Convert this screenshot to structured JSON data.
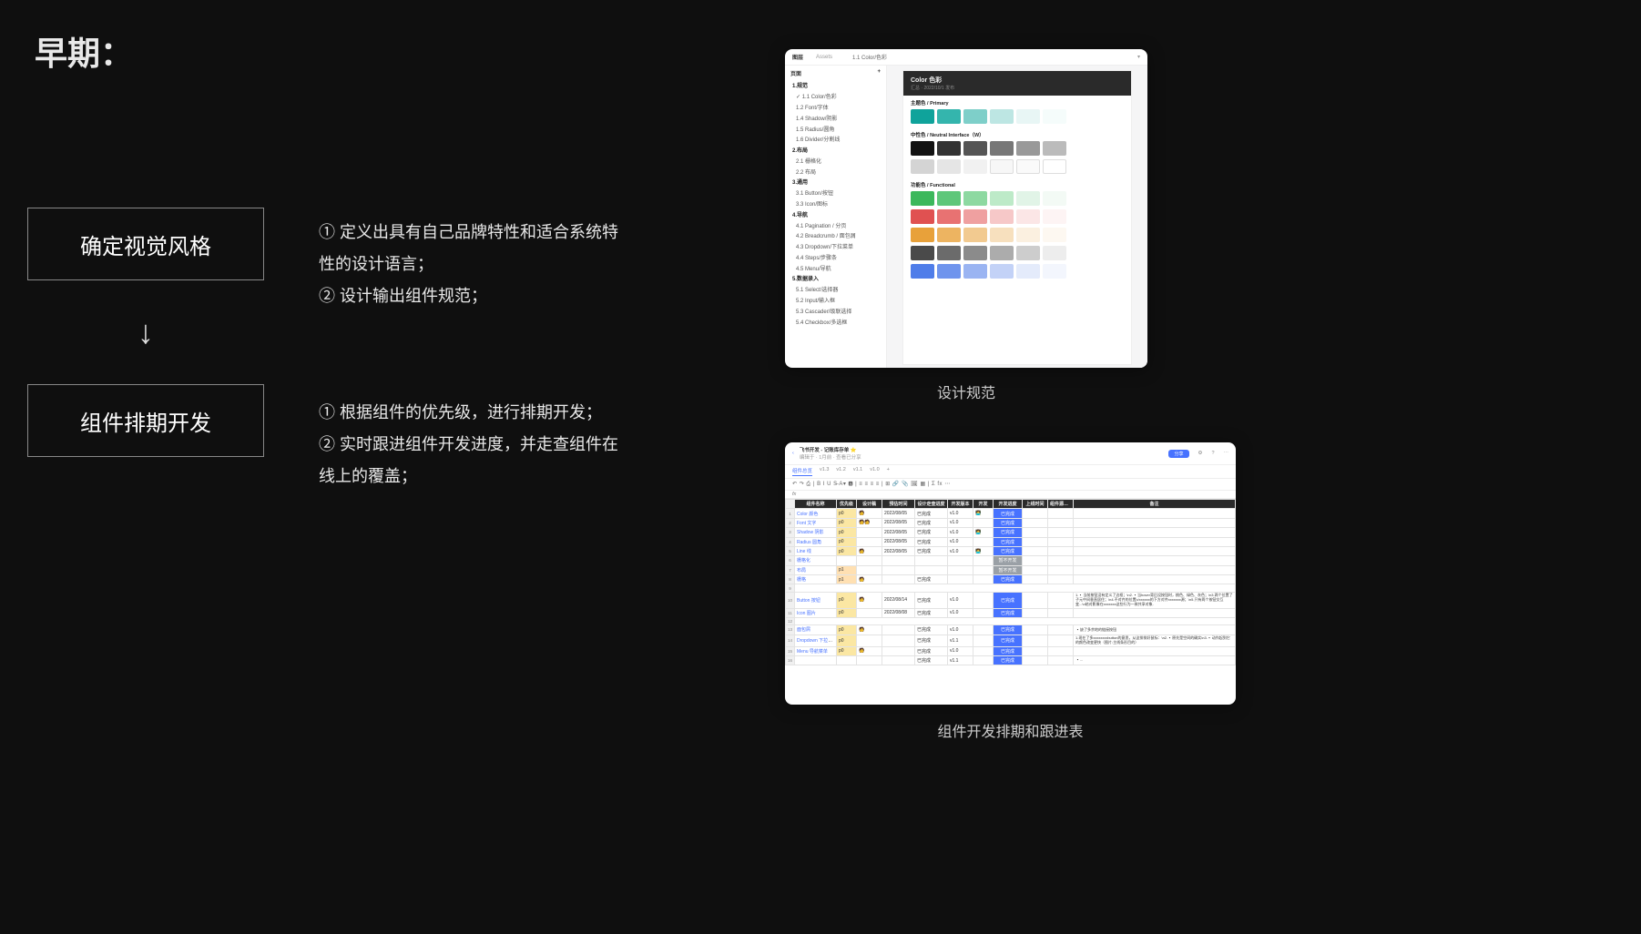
{
  "title": "早期：",
  "steps": {
    "step1": {
      "title": "确定视觉风格",
      "bullets": [
        "① 定义出具有自己品牌特性和适合系统特性的设计语言；",
        "② 设计输出组件规范；"
      ]
    },
    "step2": {
      "title": "组件排期开发",
      "bullets": [
        "① 根据组件的优先级，进行排期开发；",
        "② 实时跟进组件开发进度，并走查组件在线上的覆盖；"
      ]
    }
  },
  "arrow": "↓",
  "captions": {
    "spec": "设计规范",
    "sheet": "组件开发排期和跟进表"
  },
  "spec": {
    "topbar": {
      "layers": "图层",
      "assets": "Assets",
      "crumb": "1.1 Color/色彩",
      "crumbHint": "1.1 Color 色彩"
    },
    "sidebarHeader": "页面",
    "sidebarPlus": "+",
    "tree": [
      {
        "label": "1.规范",
        "head": true
      },
      {
        "label": "1.1 Color/色彩",
        "active": true
      },
      {
        "label": "1.2 Font/字体"
      },
      {
        "label": "1.4 Shadow/阴影"
      },
      {
        "label": "1.5 Radius/圆角"
      },
      {
        "label": "1.6 Divider/分割线"
      },
      {
        "label": "2.布局",
        "head": true
      },
      {
        "label": "2.1 栅格化"
      },
      {
        "label": "2.2 布局"
      },
      {
        "label": "3.通用",
        "head": true
      },
      {
        "label": "3.1 Button/按钮"
      },
      {
        "label": "3.3 Icon/图标"
      },
      {
        "label": "4.导航",
        "head": true
      },
      {
        "label": "4.1 Pagination / 分页"
      },
      {
        "label": "4.2 Breadcrumb / 面包屑"
      },
      {
        "label": "4.3 Dropdown/下拉菜单"
      },
      {
        "label": "4.4 Steps/步骤条"
      },
      {
        "label": "4.5 Menu/导航"
      },
      {
        "label": "5.数据录入",
        "head": true
      },
      {
        "label": "5.1 Select/选择器"
      },
      {
        "label": "5.2 Input/输入框"
      },
      {
        "label": "5.3 Cascader/级联选择"
      },
      {
        "label": "5.4 Checkbox/多选框"
      }
    ],
    "artboard": {
      "title": "Color 色彩",
      "subtitle": "汇总 · 2022/10/1 发布",
      "sections": [
        {
          "name": "主题色 / Primary",
          "rows": [
            [
              "#0fa39b",
              "#34b5ad",
              "#7ecfc9",
              "#bde6e3",
              "#e8f6f5",
              "#f5fcfb"
            ]
          ]
        },
        {
          "name": "中性色 / Neutral Interface（W）",
          "rows": [
            [
              "#121212",
              "#333333",
              "#555555",
              "#777777",
              "#999999",
              "#bbbbbb"
            ],
            [
              "#d4d4d4",
              "#e5e5e5",
              "#f1f1f1",
              "#f7f7f7",
              "#fafafa",
              "#ffffff"
            ]
          ]
        },
        {
          "name": "功能色 / Functional",
          "rows": [
            [
              "#3cb85c",
              "#5ec77a",
              "#8dd9a1",
              "#bdeac8",
              "#e1f4e7",
              "#f3faf5"
            ],
            [
              "#e05151",
              "#e87272",
              "#efa0a0",
              "#f6c8c8",
              "#fbe6e6",
              "#fdf4f4"
            ],
            [
              "#e8a13a",
              "#edb461",
              "#f2ca90",
              "#f7e0be",
              "#fbf0e0",
              "#fdf8f1"
            ],
            [
              "#4a4a4a",
              "#6b6b6b",
              "#8b8b8b",
              "#acacac",
              "#cdcdcd",
              "#ededed"
            ],
            [
              "#4f7de9",
              "#6f94ed",
              "#9ab4f2",
              "#c3d2f7",
              "#e4ebfb",
              "#f3f6fd"
            ]
          ]
        }
      ]
    }
  },
  "sheet": {
    "docTitle": "飞书开发 - 记账库存单",
    "docSub": "编辑于 · 1月前 · 查看已分享",
    "share": "分享",
    "tabs": [
      "组件总览",
      "v1.3",
      "v1.2",
      "v1.1",
      "v1.0",
      "+"
    ],
    "toolbarGlyphs": "↶ ↷ ⎙ | B I U S̶ A▾ 🅰 | ≡ ≡ ≡ ≡ | ⊞ 🔗 📎 🖼 ▦ | Σ fx ⋯",
    "fx": "fx",
    "headers": [
      "",
      "组件名称",
      "优先级",
      "设计稿",
      "预估时间",
      "设计走查进度",
      "开发版本",
      "开发",
      "开发进度",
      "上线时间",
      "组件源优化",
      "备注"
    ],
    "col0": [
      "1",
      "2",
      "3",
      "4",
      "5",
      "6",
      "7",
      "8",
      "9",
      "10",
      "11",
      "12",
      "13",
      "14",
      "15",
      "16",
      "17",
      "18",
      "19"
    ],
    "rows": [
      {
        "n": "Color 颜色",
        "p": "p0",
        "owner": "🧑",
        "date": "2022/08/05",
        "ds": "已完成",
        "ver": "v1.0",
        "dev": "👩‍💻",
        "dp": "已完成",
        "note": ""
      },
      {
        "n": "Font 文字",
        "p": "p0",
        "owner": "🧑🧑",
        "date": "2022/08/05",
        "ds": "已完成",
        "ver": "v1.0",
        "dev": "",
        "dp": "已完成",
        "note": ""
      },
      {
        "n": "Shadow 阴影",
        "p": "p0",
        "owner": "",
        "date": "2022/08/05",
        "ds": "已完成",
        "ver": "v1.0",
        "dev": "👩‍💻",
        "dp": "已完成",
        "note": ""
      },
      {
        "n": "Radius 圆角",
        "p": "p0",
        "owner": "",
        "date": "2022/08/05",
        "ds": "已完成",
        "ver": "v1.0",
        "dev": "",
        "dp": "已完成",
        "note": ""
      },
      {
        "n": "Line 线",
        "p": "p0",
        "owner": "🧑",
        "date": "2022/08/05",
        "ds": "已完成",
        "ver": "v1.0",
        "dev": "👩‍💻",
        "dp": "已完成",
        "note": ""
      },
      {
        "n": "栅格化",
        "p": "",
        "owner": "",
        "date": "",
        "ds": "",
        "ver": "",
        "dev": "",
        "dp": "暂不开发",
        "gray": true,
        "note": ""
      },
      {
        "n": "布局",
        "p": "p1",
        "owner": "",
        "date": "",
        "ds": "",
        "ver": "",
        "dev": "",
        "dp": "暂不开发",
        "gray": true,
        "note": ""
      },
      {
        "n": "栅格",
        "p": "p1",
        "owner": "🧑",
        "date": "",
        "ds": "已完成",
        "ver": "",
        "dev": "",
        "dp": "已完成",
        "note": ""
      },
      {
        "spacer": true
      },
      {
        "n": "Button 按钮",
        "p": "p0",
        "owner": "🧑",
        "date": "2022/08/14",
        "ds": "已完成",
        "ver": "v1.0",
        "dev": "",
        "dp": "已完成",
        "note": "1.▪️当前按钮没有定义了边框；\\n2.▪️当hover背后设按钮时，桃色、绿色、灰色；\\n3.两个位置了子元中间垂直居住；\\n4.不对齐的位置x/xxxxxx的下方对齐xxxxxxx源；\\n5.只有两个按钮交互变...\\n结对影像在xxxxxxx这些行为一致共享对象."
      },
      {
        "n": "Icon 图片",
        "p": "p0",
        "owner": "",
        "date": "2022/08/08",
        "ds": "已完成",
        "ver": "v1.0",
        "dev": "",
        "dp": "已完成",
        "note": ""
      },
      {
        "spacer": true
      },
      {
        "n": "面包屑",
        "p": "p0",
        "owner": "🧑",
        "date": "",
        "ds": "已完成",
        "ver": "v1.0",
        "dev": "",
        "dp": "已完成",
        "note": "▪️缺了多余地的链接按钮"
      },
      {
        "n": "Dropdown 下拉菜单",
        "p": "p0",
        "owner": "",
        "date": "",
        "ds": "已完成",
        "ver": "v1.1",
        "dev": "",
        "dp": "已完成",
        "note": "1.现在了多xxxxxxxxbutton的意思，从这排排好鼠标：\\n2.▪️原先是空间的确实\\n3.▪️动作起到它的颜色改变更快（图片:主线条形目的）"
      },
      {
        "n": "Menu 导航菜单",
        "p": "p0",
        "owner": "🧑",
        "date": "",
        "ds": "已完成",
        "ver": "v1.0",
        "dev": "",
        "dp": "已完成",
        "note": ""
      },
      {
        "n": "",
        "p": "",
        "owner": "",
        "date": "",
        "ds": "已完成",
        "ver": "v1.1",
        "dev": "",
        "dp": "已完成",
        "note": "▪️..."
      }
    ]
  }
}
